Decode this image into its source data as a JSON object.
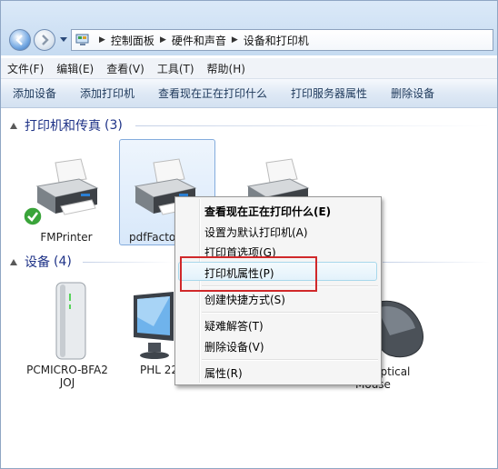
{
  "address": {
    "crumbs": [
      "控制面板",
      "硬件和声音",
      "设备和打印机"
    ]
  },
  "menubar": {
    "items": [
      "文件(F)",
      "编辑(E)",
      "查看(V)",
      "工具(T)",
      "帮助(H)"
    ]
  },
  "commandbar": {
    "items": [
      "添加设备",
      "添加打印机",
      "查看现在正在打印什么",
      "打印服务器属性",
      "删除设备"
    ]
  },
  "groups": {
    "printers": {
      "title": "打印机和传真",
      "count": "(3)"
    },
    "devices": {
      "title": "设备",
      "count": "(4)"
    }
  },
  "printers": [
    {
      "label": "FMPrinter",
      "default": true
    },
    {
      "label": "pdfFactory",
      "selected": true
    },
    {
      "label": ""
    }
  ],
  "devices": [
    {
      "label_line1": "PCMICRO-BFA2",
      "label_line2": "JOJ"
    },
    {
      "label_line1": "PHL 22",
      "label_line2": ""
    },
    {
      "label_line1": "Optical",
      "label_line2": "Mouse"
    }
  ],
  "context_menu": {
    "items": [
      {
        "label": "查看现在正在打印什么(E)",
        "bold": true
      },
      {
        "label": "设置为默认打印机(A)"
      },
      {
        "label": "打印首选项(G)"
      },
      {
        "label": "打印机属性(P)",
        "highlighted": true
      },
      {
        "label": "创建快捷方式(S)"
      },
      {
        "label": "疑难解答(T)"
      },
      {
        "label": "删除设备(V)"
      },
      {
        "label": "属性(R)"
      }
    ]
  },
  "colors": {
    "highlight_box": "#d0282a",
    "group_title": "#1e3287",
    "command_text": "#1e395b"
  }
}
